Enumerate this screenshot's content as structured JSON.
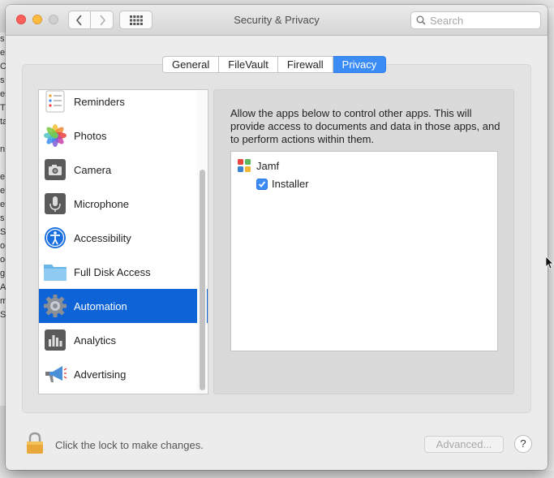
{
  "window": {
    "title": "Security & Privacy",
    "search_placeholder": "Search"
  },
  "tabs": [
    {
      "label": "General",
      "active": false
    },
    {
      "label": "FileVault",
      "active": false
    },
    {
      "label": "Firewall",
      "active": false
    },
    {
      "label": "Privacy",
      "active": true
    }
  ],
  "sidebar": {
    "items": [
      {
        "label": "Reminders",
        "icon": "reminders-icon",
        "selected": false
      },
      {
        "label": "Photos",
        "icon": "photos-icon",
        "selected": false
      },
      {
        "label": "Camera",
        "icon": "camera-icon",
        "selected": false
      },
      {
        "label": "Microphone",
        "icon": "microphone-icon",
        "selected": false
      },
      {
        "label": "Accessibility",
        "icon": "accessibility-icon",
        "selected": false
      },
      {
        "label": "Full Disk Access",
        "icon": "folder-icon",
        "selected": false
      },
      {
        "label": "Automation",
        "icon": "gear-icon",
        "selected": true
      },
      {
        "label": "Analytics",
        "icon": "analytics-icon",
        "selected": false
      },
      {
        "label": "Advertising",
        "icon": "megaphone-icon",
        "selected": false
      }
    ]
  },
  "detail": {
    "description": "Allow the apps below to control other apps. This will provide access to documents and data in those apps, and to perform actions within them.",
    "app": {
      "name": "Jamf",
      "icon": "jamf-icon"
    },
    "sub_app": {
      "name": "Installer",
      "checked": true
    }
  },
  "footer": {
    "lock_text": "Click the lock to make changes.",
    "advanced_label": "Advanced...",
    "help_label": "?"
  },
  "background_text": [
    "s",
    "es",
    "C",
    "s",
    "es",
    "T",
    "ta",
    "",
    "n",
    "",
    "e",
    "el",
    "es",
    "s",
    "S",
    "oc",
    "oc",
    "g",
    "Ac",
    "m",
    "Se"
  ],
  "colors": {
    "accent": "#3b8cf5",
    "selection": "#0e63d7"
  }
}
